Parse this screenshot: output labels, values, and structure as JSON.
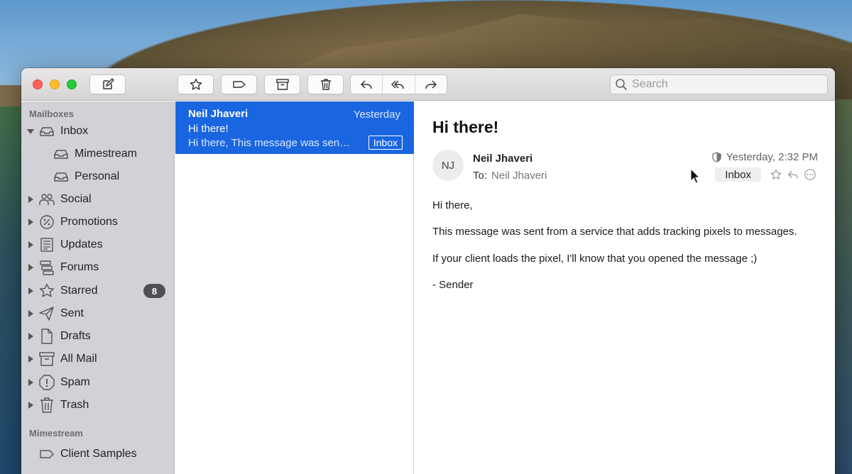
{
  "toolbar": {
    "compose_icon": "compose-icon",
    "star_icon": "star-icon",
    "label_icon": "tag-icon",
    "archive_icon": "archive-icon",
    "trash_icon": "trash-icon",
    "reply_icon": "reply-icon",
    "reply_all_icon": "reply-all-icon",
    "forward_icon": "forward-icon"
  },
  "search": {
    "placeholder": "Search"
  },
  "sidebar": {
    "mailboxes_heading": "Mailboxes",
    "items": [
      {
        "label": "Inbox",
        "icon": "inbox-tray-icon"
      },
      {
        "label": "Mimestream",
        "icon": "inbox-tray-icon"
      },
      {
        "label": "Personal",
        "icon": "inbox-tray-icon"
      },
      {
        "label": "Social",
        "icon": "people-icon"
      },
      {
        "label": "Promotions",
        "icon": "percent-tag-icon"
      },
      {
        "label": "Updates",
        "icon": "newspaper-icon"
      },
      {
        "label": "Forums",
        "icon": "forums-icon"
      },
      {
        "label": "Starred",
        "icon": "star-icon",
        "badge": "8"
      },
      {
        "label": "Sent",
        "icon": "paperplane-icon"
      },
      {
        "label": "Drafts",
        "icon": "draft-icon"
      },
      {
        "label": "All Mail",
        "icon": "archivebox-icon"
      },
      {
        "label": "Spam",
        "icon": "spam-icon"
      },
      {
        "label": "Trash",
        "icon": "trash-icon"
      }
    ],
    "labels_heading": "Mimestream",
    "labels": [
      {
        "label": "Client Samples",
        "icon": "label-tag-icon"
      }
    ]
  },
  "message_list": {
    "rows": [
      {
        "from": "Neil Jhaveri",
        "date": "Yesterday",
        "subject": "Hi there!",
        "snippet": "Hi there, This message was sent from a service that adds tracking pixels to messages.",
        "label": "Inbox"
      }
    ]
  },
  "reader": {
    "subject": "Hi there!",
    "avatar_initials": "NJ",
    "from": "Neil Jhaveri",
    "to_label": "To:",
    "to_name": "Neil Jhaveri",
    "date": "Yesterday, 2:32 PM",
    "label": "Inbox",
    "body": [
      "Hi there,",
      "This message was sent from a service that adds tracking pixels to messages.",
      "If your client loads the pixel, I'll know that you opened the message ;)",
      "- Sender"
    ]
  },
  "colors": {
    "selection": "#1a66e0",
    "badge": "#4f4f54"
  }
}
